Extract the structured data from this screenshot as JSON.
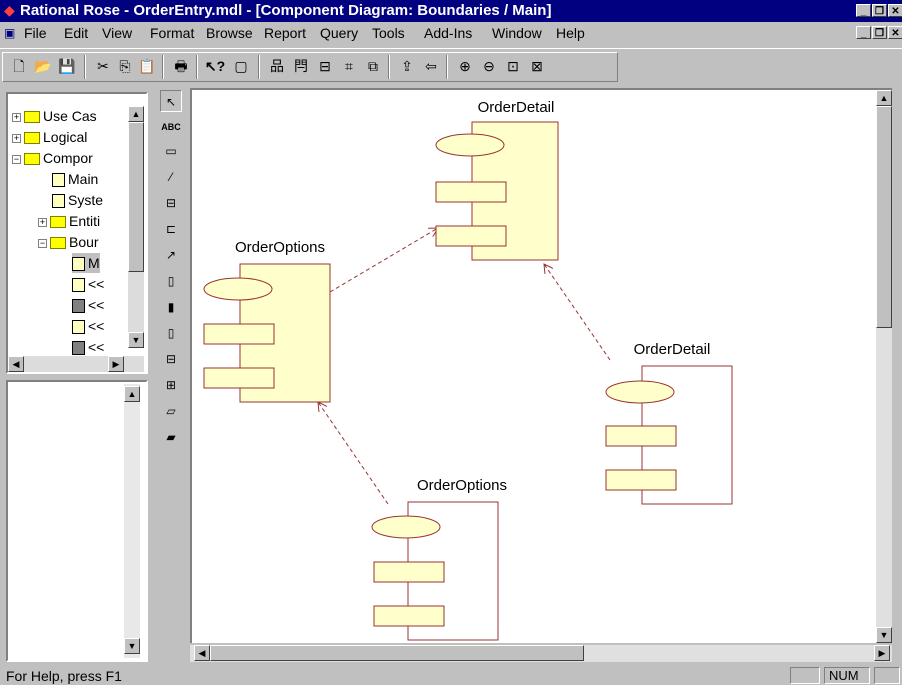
{
  "window": {
    "title": "Rational Rose - OrderEntry.mdl - [Component Diagram: Boundaries / Main]"
  },
  "menu": {
    "items": [
      "File",
      "Edit",
      "View",
      "Format",
      "Browse",
      "Report",
      "Query",
      "Tools",
      "Add-Ins",
      "Window",
      "Help"
    ]
  },
  "toolbar": {
    "icons": [
      "new-icon",
      "open-icon",
      "save-icon",
      "cut-icon",
      "copy-icon",
      "paste-icon",
      "print-icon",
      "context-help-icon",
      "view-documentation-icon",
      "browse-class-diagram-icon",
      "browse-interaction-diagram-icon",
      "browse-component-diagram-icon",
      "browse-state-diagram-icon",
      "browse-deployment-diagram-icon",
      "browse-parent-icon",
      "browse-previous-diagram-icon",
      "zoom-in-icon",
      "zoom-out-icon",
      "fit-in-window-icon",
      "undo-fit-in-window-icon"
    ]
  },
  "browser": {
    "items": [
      {
        "label": "Use Cas",
        "type": "folder",
        "expander": "+"
      },
      {
        "label": "Logical ",
        "type": "folder",
        "expander": "+"
      },
      {
        "label": "Compor",
        "type": "folder",
        "expander": "-"
      },
      {
        "label": "Main",
        "type": "diagram"
      },
      {
        "label": "Syste",
        "type": "diagram"
      },
      {
        "label": "Entiti",
        "type": "folder",
        "expander": "+"
      },
      {
        "label": "Bour",
        "type": "folder",
        "expander": "-"
      },
      {
        "label": "M",
        "type": "diagram",
        "selected": true
      },
      {
        "label": "<<",
        "type": "component"
      },
      {
        "label": "<<",
        "type": "component"
      },
      {
        "label": "<<",
        "type": "component"
      },
      {
        "label": "<<",
        "type": "component"
      }
    ]
  },
  "toolbox": {
    "tools": [
      "selection-tool",
      "text-tool",
      "note-tool",
      "anchor-note-tool",
      "component-tool",
      "package-tool",
      "dependency-tool",
      "main-program-tool",
      "subprogram-spec-tool",
      "subprogram-body-tool",
      "package-spec-tool",
      "package-body-tool",
      "task-spec-tool",
      "task-body-tool"
    ],
    "text_tool_label": "ABC"
  },
  "diagram": {
    "components": [
      {
        "name": "OrderDetail",
        "kind": "spec"
      },
      {
        "name": "OrderOptions",
        "kind": "spec"
      },
      {
        "name": "OrderDetail",
        "kind": "body"
      },
      {
        "name": "OrderOptions",
        "kind": "body"
      }
    ],
    "dependencies": [
      {
        "from": "OrderOptions",
        "to": "OrderDetail"
      },
      {
        "from": "OrderDetail",
        "to": "OrderDetail"
      },
      {
        "from": "OrderOptions",
        "to": "OrderOptions"
      }
    ],
    "colors": {
      "fill": "#ffffcc",
      "stroke": "#993333"
    }
  },
  "status": {
    "help": "For Help, press F1",
    "num": "NUM"
  }
}
